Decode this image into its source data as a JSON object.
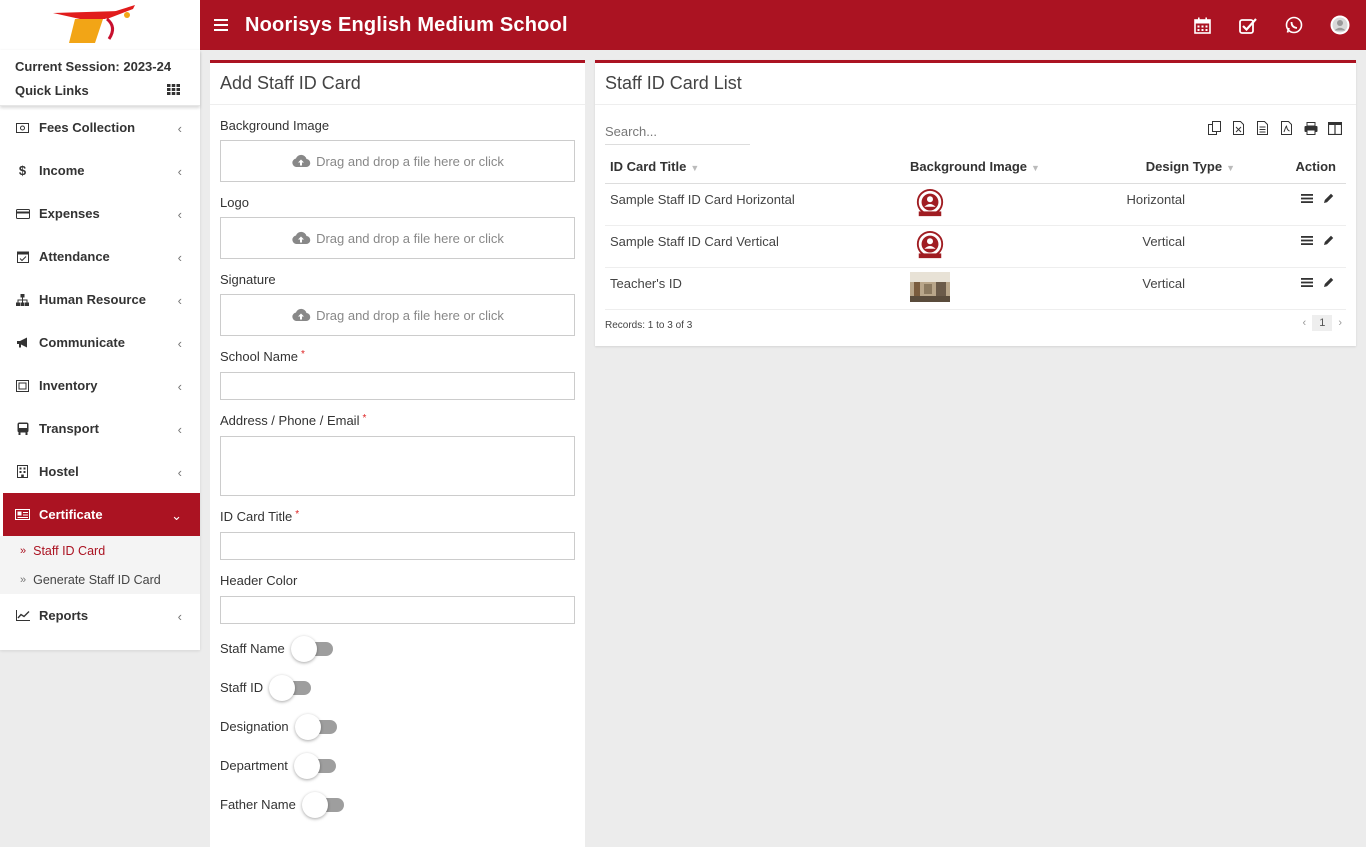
{
  "header": {
    "school_name": "Noorisys English Medium School"
  },
  "sidebar": {
    "session_label": "Current Session: 2023-24",
    "quick_links_label": "Quick Links",
    "items": [
      {
        "label": "Fees Collection",
        "icon": "money-icon"
      },
      {
        "label": "Income",
        "icon": "dollar-icon"
      },
      {
        "label": "Expenses",
        "icon": "credit-card-icon"
      },
      {
        "label": "Attendance",
        "icon": "calendar-check-icon"
      },
      {
        "label": "Human Resource",
        "icon": "sitemap-icon"
      },
      {
        "label": "Communicate",
        "icon": "bullhorn-icon"
      },
      {
        "label": "Inventory",
        "icon": "inventory-icon"
      },
      {
        "label": "Transport",
        "icon": "bus-icon"
      },
      {
        "label": "Hostel",
        "icon": "building-icon"
      },
      {
        "label": "Certificate",
        "icon": "certificate-icon"
      },
      {
        "label": "Reports",
        "icon": "line-chart-icon"
      }
    ],
    "submenu": [
      {
        "label": "Staff ID Card"
      },
      {
        "label": "Generate Staff ID Card"
      }
    ]
  },
  "add_form": {
    "title": "Add Staff ID Card",
    "background_label": "Background Image",
    "logo_label": "Logo",
    "signature_label": "Signature",
    "dropzone_text": "Drag and drop a file here or click",
    "school_name_label": "School Name",
    "address_label": "Address / Phone / Email",
    "id_card_title_label": "ID Card Title",
    "header_color_label": "Header Color",
    "required_mark": "*",
    "toggles": [
      {
        "label": "Staff Name"
      },
      {
        "label": "Staff ID"
      },
      {
        "label": "Designation"
      },
      {
        "label": "Department"
      },
      {
        "label": "Father Name"
      }
    ]
  },
  "list": {
    "title": "Staff ID Card List",
    "search_placeholder": "Search...",
    "columns": [
      "ID Card Title",
      "Background Image",
      "Design Type",
      "Action"
    ],
    "rows": [
      {
        "title": "Sample Staff ID Card Horizontal",
        "design": "Horizontal",
        "thumb": "seal"
      },
      {
        "title": "Sample Staff ID Card Vertical",
        "design": "Vertical",
        "thumb": "seal"
      },
      {
        "title": "Teacher's ID",
        "design": "Vertical",
        "thumb": "photo"
      }
    ],
    "records_text": "Records: 1 to 3 of 3",
    "page": "1"
  },
  "colors": {
    "brand": "#ab1322"
  }
}
